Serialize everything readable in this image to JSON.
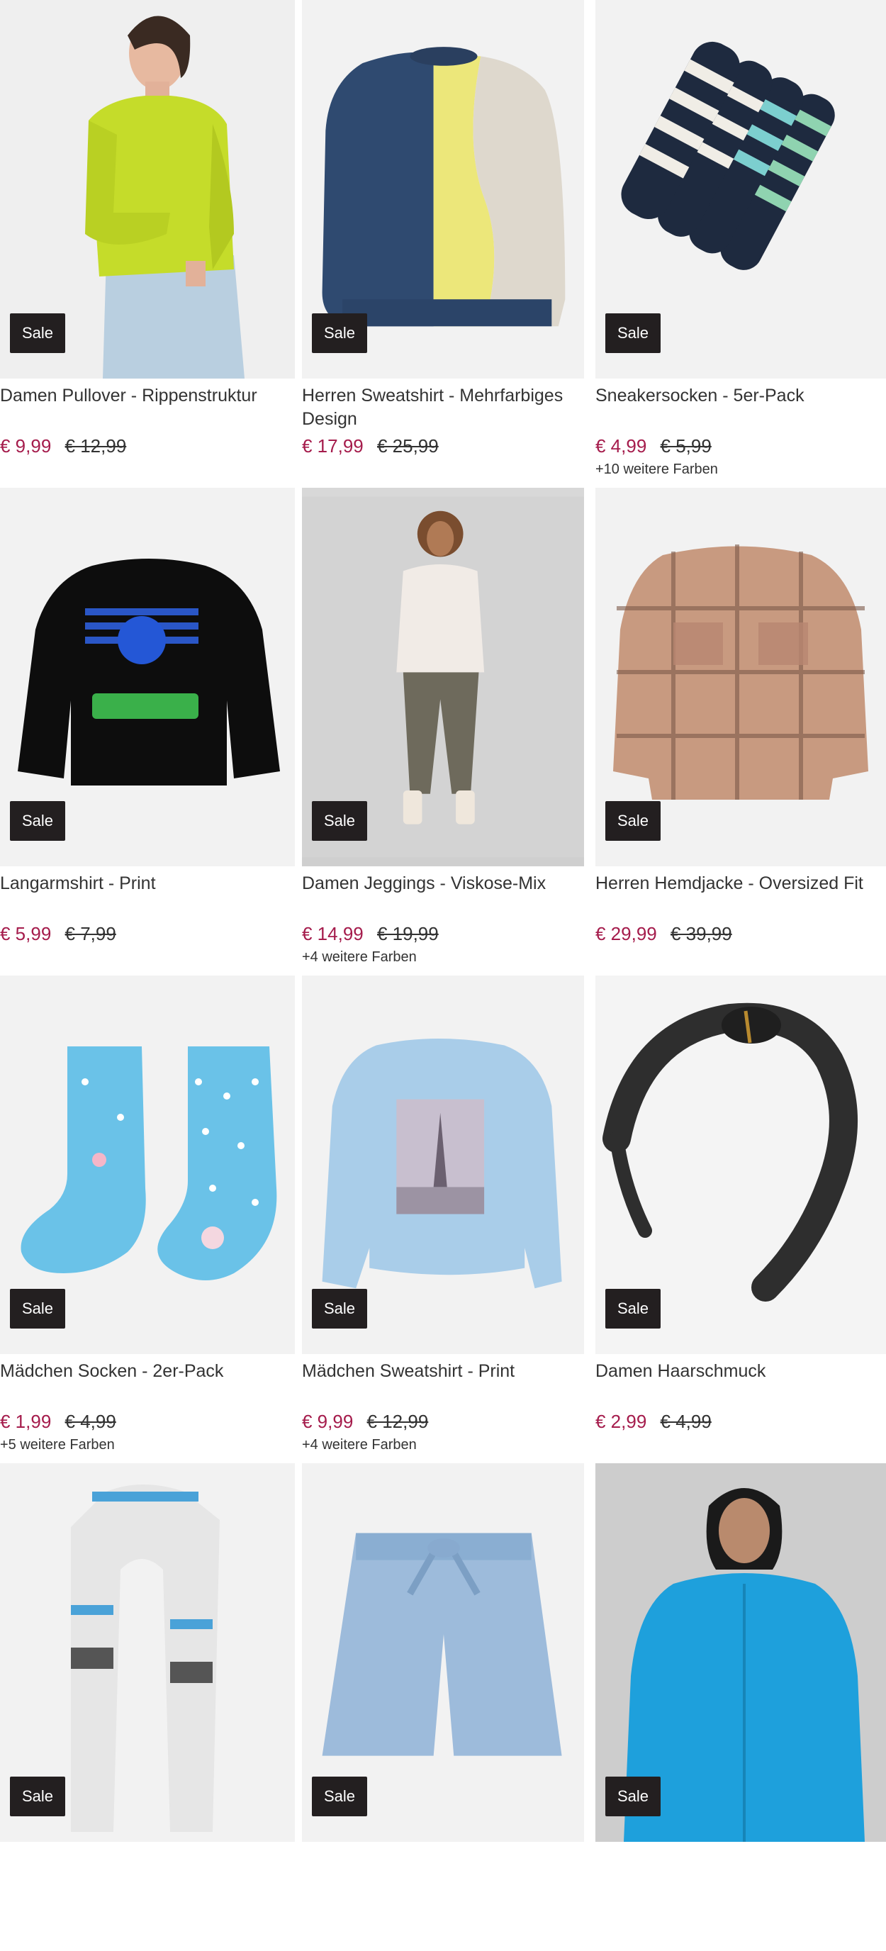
{
  "products": [
    {
      "title": "Damen Pullover - Rippenstruktur",
      "badge": "Sale",
      "price_now": "€ 9,99",
      "price_old": "€ 12,99",
      "colors": "",
      "image_icon": "yellow-pullover-image"
    },
    {
      "title": "Herren Sweatshirt - Mehrfarbiges Design",
      "badge": "Sale",
      "price_now": "€ 17,99",
      "price_old": "€ 25,99",
      "colors": "",
      "image_icon": "colorblock-sweatshirt-image"
    },
    {
      "title": "Sneakersocken - 5er-Pack",
      "badge": "Sale",
      "price_now": "€ 4,99",
      "price_old": "€ 5,99",
      "colors": "+10 weitere Farben",
      "image_icon": "striped-socks-image"
    },
    {
      "title": "Langarmshirt - Print",
      "badge": "Sale",
      "price_now": "€ 5,99",
      "price_old": "€ 7,99",
      "colors": "",
      "image_icon": "sonic-longsleeve-image"
    },
    {
      "title": "Damen Jeggings - Viskose-Mix",
      "badge": "Sale",
      "price_now": "€ 14,99",
      "price_old": "€ 19,99",
      "colors": "+4 weitere Farben",
      "image_icon": "jeggings-model-image"
    },
    {
      "title": "Herren Hemdjacke - Oversized Fit",
      "badge": "Sale",
      "price_now": "€ 29,99",
      "price_old": "€ 39,99",
      "colors": "",
      "image_icon": "plaid-shirt-jacket-image"
    },
    {
      "title": "Mädchen Socken - 2er-Pack",
      "badge": "Sale",
      "price_now": "€ 1,99",
      "price_old": "€ 4,99",
      "colors": "+5 weitere Farben",
      "image_icon": "icecream-socks-image"
    },
    {
      "title": "Mädchen Sweatshirt - Print",
      "badge": "Sale",
      "price_now": "€ 9,99",
      "price_old": "€ 12,99",
      "colors": "+4 weitere Farben",
      "image_icon": "paris-sweatshirt-image"
    },
    {
      "title": "Damen Haarschmuck",
      "badge": "Sale",
      "price_now": "€ 2,99",
      "price_old": "€ 4,99",
      "colors": "",
      "image_icon": "headband-image"
    },
    {
      "title": "",
      "badge": "Sale",
      "price_now": "",
      "price_old": "",
      "colors": "",
      "image_icon": "checked-scarf-image"
    },
    {
      "title": "",
      "badge": "Sale",
      "price_now": "",
      "price_old": "",
      "colors": "",
      "image_icon": "denim-shorts-image"
    },
    {
      "title": "",
      "badge": "Sale",
      "price_now": "",
      "price_old": "",
      "colors": "",
      "image_icon": "blue-hoodie-model-image"
    }
  ],
  "colors": {
    "sale_badge_bg": "#231f20",
    "price_now": "#a51c4c",
    "text": "#333333",
    "image_bg": "#f2f2f2"
  }
}
